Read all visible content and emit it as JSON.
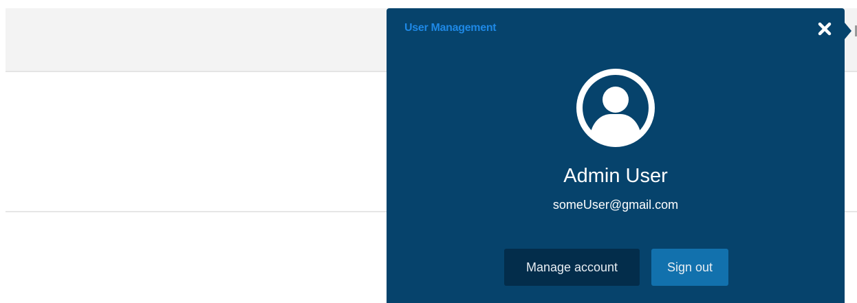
{
  "panel": {
    "title": "User Management",
    "title_color": "#1e88e5",
    "background": "#06436c",
    "close_icon": "close-x-icon"
  },
  "user": {
    "avatar_icon": "user-avatar-icon",
    "name": "Admin User",
    "email": "someUser@gmail.com"
  },
  "actions": {
    "manage_label": "Manage account",
    "signout_label": "Sign out"
  },
  "colors": {
    "manage_button": "#032d4b",
    "signout_button": "#1271ad"
  }
}
